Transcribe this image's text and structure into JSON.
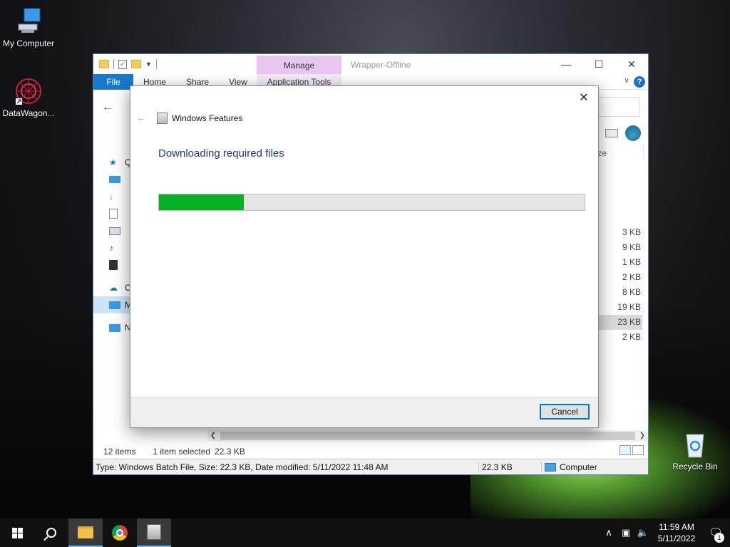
{
  "desktop": {
    "icons": [
      {
        "label": "My Computer",
        "icon": "computer-icon"
      },
      {
        "label": "DataWagon...",
        "icon": "datawagon-shortcut-icon"
      },
      {
        "label": "Recycle Bin",
        "icon": "recycle-bin-icon"
      }
    ]
  },
  "explorer": {
    "title": "Wrapper-Offline",
    "manage_tab": "Manage",
    "ribbon_tabs": [
      "File",
      "Home",
      "Share",
      "View"
    ],
    "app_tools": "Application Tools",
    "nav_partial": [
      "Q",
      "",
      "",
      "",
      "",
      "",
      "",
      "O",
      "M",
      "N"
    ],
    "size_header": "ze",
    "file_sizes": [
      "3 KB",
      "9 KB",
      "1 KB",
      "2 KB",
      "8 KB",
      "19 KB",
      "23 KB",
      "2 KB"
    ],
    "selected_size_index": 6,
    "status": {
      "items_count": "12 items",
      "selection": "1 item selected",
      "selection_size": "22.3 KB"
    },
    "details_bar": {
      "description": "Type: Windows Batch File, Size: 22.3 KB, Date modified: 5/11/2022 11:48 AM",
      "size": "22.3 KB",
      "location": "Computer"
    }
  },
  "dialog": {
    "app_title": "Windows Features",
    "heading": "Downloading required files",
    "progress_fraction": 0.2,
    "progress_color": "#06b025",
    "cancel_label": "Cancel"
  },
  "taskbar": {
    "items": [
      "start-icon",
      "search-icon",
      "file-explorer-icon",
      "chrome-icon",
      "windows-features-icon"
    ],
    "time": "11:59 AM",
    "date": "5/11/2022",
    "notification_count": "1"
  }
}
